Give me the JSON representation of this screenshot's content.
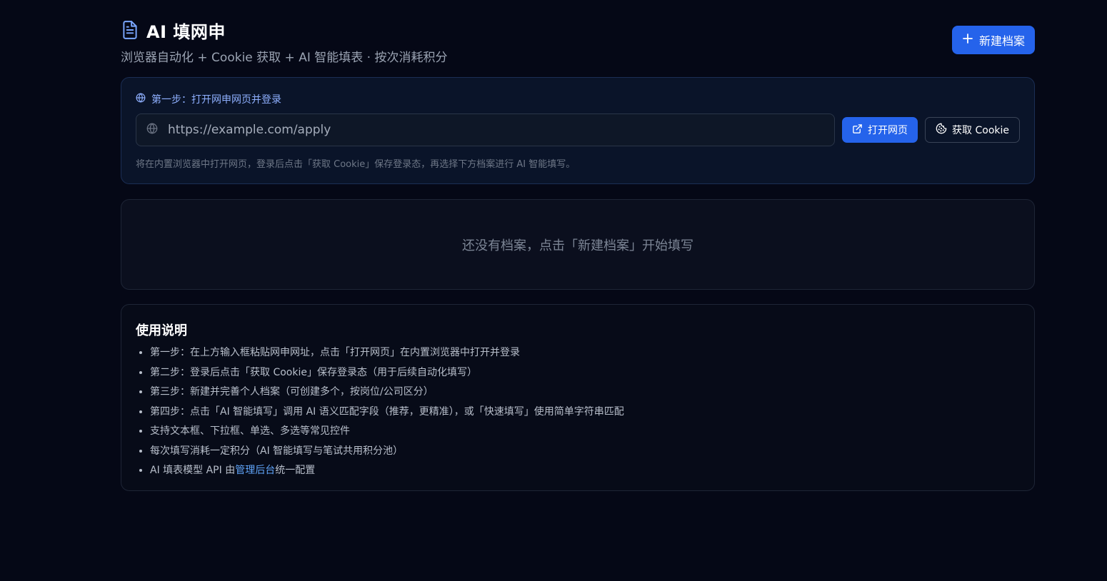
{
  "header": {
    "title": "AI 填网申",
    "subtitle": "浏览器自动化 + Cookie 获取 + AI 智能填表 · 按次消耗积分",
    "new_profile_label": "新建档案"
  },
  "step": {
    "label": "第一步：打开网申网页并登录",
    "url_placeholder": "https://example.com/apply",
    "open_label": "打开网页",
    "cookie_label": "获取 Cookie",
    "hint": "将在内置浏览器中打开网页，登录后点击「获取 Cookie」保存登录态，再选择下方档案进行 AI 智能填写。"
  },
  "empty": {
    "text": "还没有档案，点击「新建档案」开始填写"
  },
  "help": {
    "title": "使用说明",
    "items": [
      "第一步：在上方输入框粘贴网申网址，点击「打开网页」在内置浏览器中打开并登录",
      "第二步：登录后点击「获取 Cookie」保存登录态（用于后续自动化填写）",
      "第三步：新建并完善个人档案（可创建多个，按岗位/公司区分）",
      "第四步：点击「AI 智能填写」调用 AI 语义匹配字段（推荐，更精准），或「快速填写」使用简单字符串匹配",
      "支持文本框、下拉框、单选、多选等常见控件",
      "每次填写消耗一定积分（AI 智能填写与笔试共用积分池）"
    ],
    "last_prefix": "AI 填表模型 API 由",
    "last_link": "管理后台",
    "last_suffix": "统一配置"
  },
  "colors": {
    "accent": "#2563eb",
    "link": "#60a5fa",
    "background": "#050816"
  },
  "icons": [
    "document-icon",
    "plus-icon",
    "globe-icon",
    "external-link-icon",
    "cookie-icon"
  ]
}
